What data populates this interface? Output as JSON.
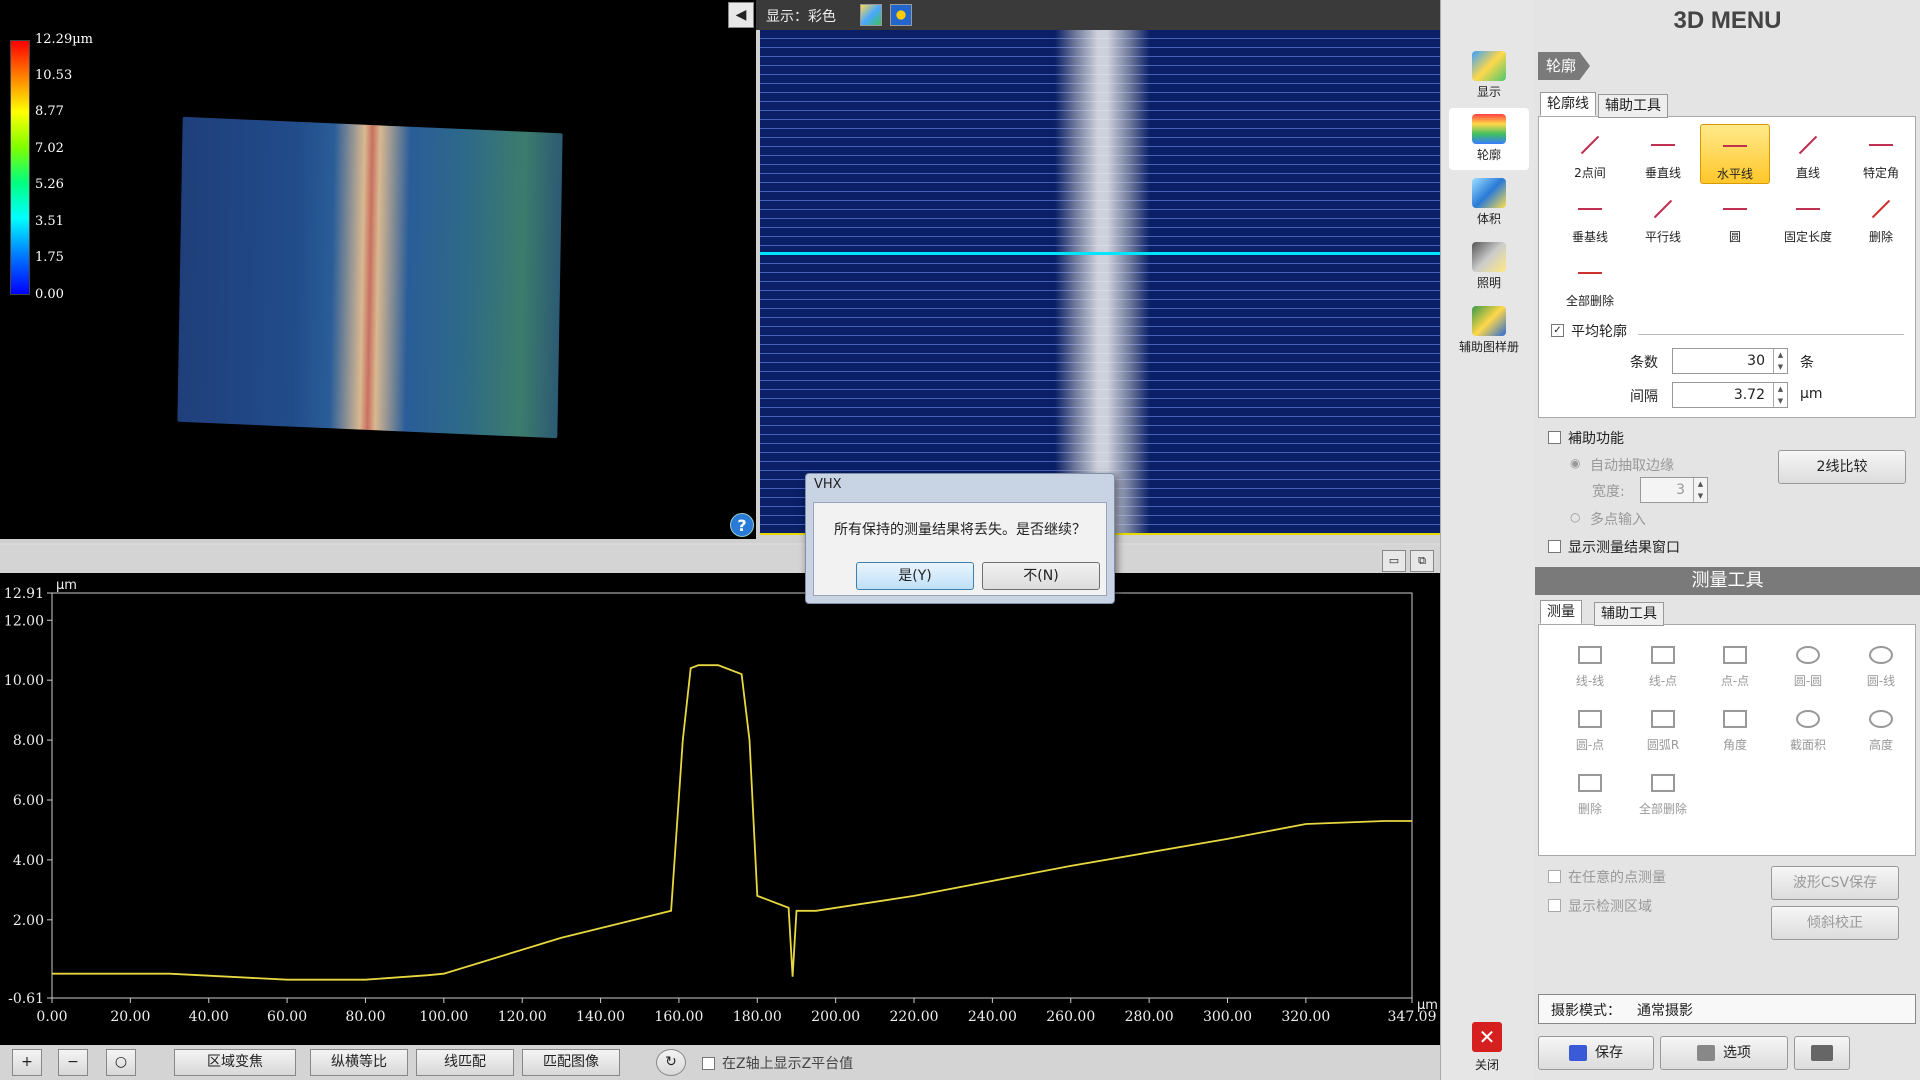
{
  "view3d": {
    "legend_labels": [
      "12.29µm",
      "10.53",
      "8.77",
      "7.02",
      "5.26",
      "3.51",
      "1.75",
      "0.00"
    ],
    "help_icon": "?"
  },
  "image_view": {
    "display_label": "显示：彩色",
    "back_icon": "◀"
  },
  "graph": {
    "y_unit": "µm",
    "x_unit": "µm",
    "y_ticks": [
      "12.91",
      "12.00",
      "10.00",
      "8.00",
      "6.00",
      "4.00",
      "2.00",
      "-0.61"
    ],
    "x_ticks": [
      "0.00",
      "20.00",
      "40.00",
      "60.00",
      "80.00",
      "100.00",
      "120.00",
      "140.00",
      "160.00",
      "180.00",
      "200.00",
      "220.00",
      "240.00",
      "260.00",
      "280.00",
      "300.00",
      "320.00",
      "347.09"
    ],
    "line_color": "#e8d840"
  },
  "chart_data": {
    "type": "line",
    "xlabel": "µm",
    "ylabel": "µm",
    "xlim": [
      0,
      347.09
    ],
    "ylim": [
      -0.61,
      12.91
    ],
    "series": [
      {
        "x": [
          0,
          30,
          60,
          80,
          96,
          100,
          130,
          158,
          161,
          163,
          165,
          170,
          176,
          178,
          180,
          182,
          188,
          189,
          190,
          195,
          220,
          260,
          300,
          320,
          340,
          347.09
        ],
        "y": [
          0.2,
          0.2,
          0.0,
          0.0,
          0.15,
          0.2,
          1.4,
          2.3,
          8.0,
          10.4,
          10.5,
          10.5,
          10.2,
          8.0,
          2.8,
          2.7,
          2.4,
          0.1,
          2.3,
          2.3,
          2.8,
          3.8,
          4.7,
          5.2,
          5.3,
          5.3
        ]
      }
    ]
  },
  "toolbar": {
    "zoom_in": "+",
    "zoom_out": "−",
    "zoom_fit": "○",
    "area_focus": "区域变焦",
    "aspect_equal": "纵横等比",
    "line_match": "线匹配",
    "match_image": "匹配图像",
    "refresh_icon": "↻",
    "show_z_label": "在Z轴上显示Z平台值"
  },
  "side_icons": {
    "display": "显示",
    "profile": "轮廓",
    "volume": "体积",
    "lighting": "照明",
    "aux_sample": "辅助图样册",
    "close": "关闭",
    "close_glyph": "✕"
  },
  "menu": {
    "title": "3D MENU",
    "section_tag": "轮廓",
    "tabs": [
      "轮廓线",
      "辅助工具"
    ],
    "tools": [
      "2点间",
      "垂直线",
      "水平线",
      "直线",
      "特定角",
      "垂基线",
      "平行线",
      "圆",
      "固定长度",
      "删除",
      "全部删除"
    ],
    "avg_profile": "平均轮廓",
    "count_label": "条数",
    "count_value": "30",
    "count_unit": "条",
    "interval_label": "间隔",
    "interval_value": "3.72",
    "interval_unit": "µm",
    "aux_function": "補助功能",
    "auto_edge": "自动抽取边缘",
    "width_label": "宽度:",
    "width_value": "3",
    "multi_point": "多点输入",
    "compare_btn": "2线比较",
    "show_result_window": "显示测量结果窗口",
    "measure_section": "测量工具",
    "measure_tabs": [
      "测量",
      "辅助工具"
    ],
    "measure_tools": [
      "线-线",
      "线-点",
      "点-点",
      "圆-圆",
      "圆-线",
      "圆-点",
      "圆弧R",
      "角度",
      "截面积",
      "高度",
      "删除",
      "全部删除"
    ],
    "arbitrary_point": "在任意的点测量",
    "show_detect_area": "显示检测区域",
    "csv_save": "波形CSV保存",
    "tilt_correct": "倾斜校正",
    "shoot_mode_label": "摄影模式：",
    "shoot_mode_value": "通常摄影",
    "save": "保存",
    "options": "选项"
  },
  "dialog": {
    "title": "VHX",
    "message": "所有保持的测量结果将丢失。是否继续？",
    "yes": "是(Y)",
    "no": "不(N)"
  }
}
